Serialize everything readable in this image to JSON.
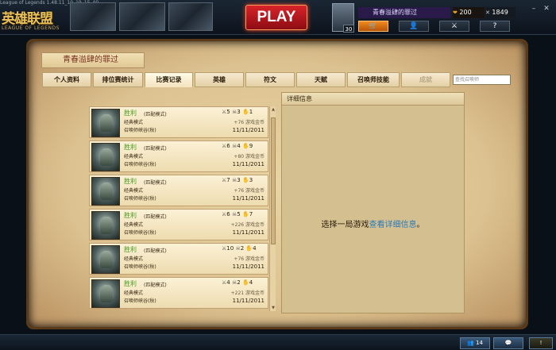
{
  "window": {
    "title": "League of Legends 1.48.11_10_19_15_40"
  },
  "logo": {
    "cn": "英雄联盟",
    "en": "LEAGUE OF LEGENDS"
  },
  "play_button": "PLAY",
  "profile": {
    "name": "青春溢肆的罪过",
    "level": "30",
    "rp": "200",
    "ip": "1849",
    "nav": [
      "store-icon",
      "profile-icon",
      "champion-icon",
      "help-icon"
    ]
  },
  "page_title": "青春溢肆的罪过",
  "tabs": [
    "个人资料",
    "排位赛统计",
    "比赛记录",
    "英雄",
    "符文",
    "天赋",
    "召唤师技能",
    "成就"
  ],
  "active_tab": "比赛记录",
  "search_placeholder": "查找召唤师",
  "matches": [
    {
      "result": "胜利",
      "queue": "(匹配模式)",
      "mode": "经典模式",
      "map": "召唤师峡谷(秋)",
      "kills": "5",
      "deaths": "3",
      "assists": "1",
      "reward": "+76 游戏金币",
      "date": "11/11/2011"
    },
    {
      "result": "胜利",
      "queue": "(匹配模式)",
      "mode": "经典模式",
      "map": "召唤师峡谷(秋)",
      "kills": "6",
      "deaths": "4",
      "assists": "9",
      "reward": "+80 游戏金币",
      "date": "11/11/2011"
    },
    {
      "result": "胜利",
      "queue": "(匹配模式)",
      "mode": "经典模式",
      "map": "召唤师峡谷(秋)",
      "kills": "7",
      "deaths": "3",
      "assists": "3",
      "reward": "+76 游戏金币",
      "date": "11/11/2011"
    },
    {
      "result": "胜利",
      "queue": "(匹配模式)",
      "mode": "经典模式",
      "map": "召唤师峡谷(秋)",
      "kills": "6",
      "deaths": "5",
      "assists": "7",
      "reward": "+226 游戏金币",
      "date": "11/11/2011"
    },
    {
      "result": "胜利",
      "queue": "(匹配模式)",
      "mode": "经典模式",
      "map": "召唤师峡谷(秋)",
      "kills": "10",
      "deaths": "2",
      "assists": "4",
      "reward": "+76 游戏金币",
      "date": "11/11/2011"
    },
    {
      "result": "胜利",
      "queue": "(匹配模式)",
      "mode": "经典模式",
      "map": "召唤师峡谷(秋)",
      "kills": "4",
      "deaths": "2",
      "assists": "4",
      "reward": "+221 游戏金币",
      "date": "11/11/2011"
    }
  ],
  "details": {
    "header": "详细信息",
    "prompt_prefix": "选择一局游戏",
    "prompt_link": "查看详细信息",
    "prompt_suffix": "。"
  },
  "bottom": {
    "friends_count": "14"
  },
  "colors": {
    "win": "#4a9a20",
    "link": "#2a7ab8",
    "play": "#d8242a",
    "parchment": "#e8d4a2"
  }
}
